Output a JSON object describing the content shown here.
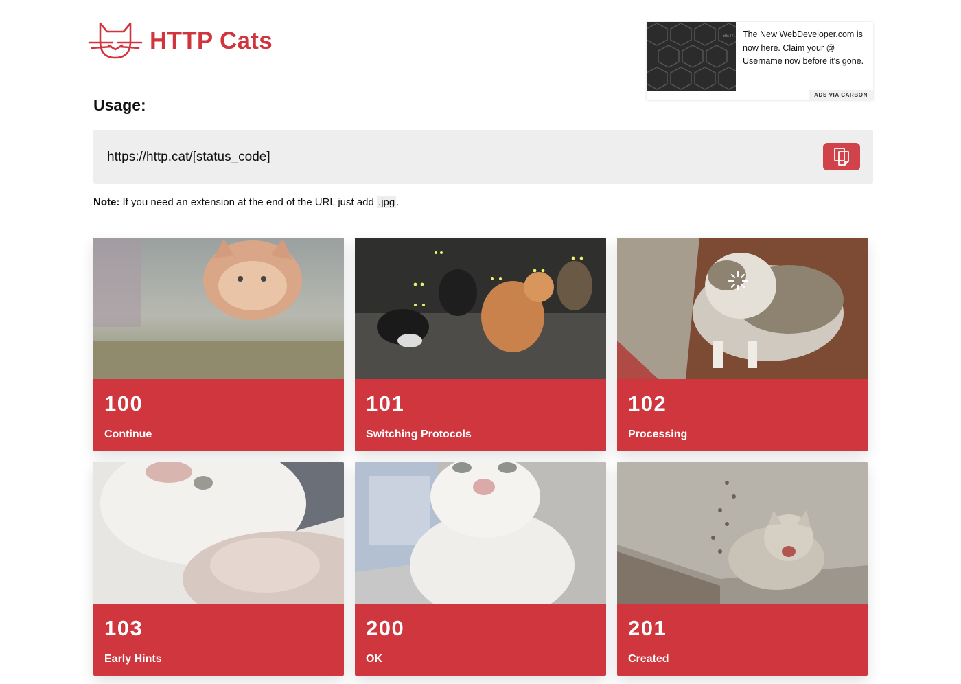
{
  "header": {
    "logo_icon": "cat-logo-icon",
    "title": "HTTP Cats",
    "brand_color": "#d0343d"
  },
  "ad": {
    "text": "The New WebDeveloper.com is now here. Claim your @ Username now before it's gone.",
    "via": "ADS VIA CARBON",
    "image_label": "BETA"
  },
  "usage": {
    "title": "Usage:",
    "url": "https://http.cat/[status_code]",
    "copy_icon": "copy-icon"
  },
  "note": {
    "bold": "Note:",
    "text": " If you need an extension at the end of the URL just add ",
    "code": ".jpg",
    "end": "."
  },
  "cards": [
    {
      "code": "100",
      "label": "Continue"
    },
    {
      "code": "101",
      "label": "Switching Protocols"
    },
    {
      "code": "102",
      "label": "Processing"
    },
    {
      "code": "103",
      "label": "Early Hints"
    },
    {
      "code": "200",
      "label": "OK"
    },
    {
      "code": "201",
      "label": "Created"
    }
  ]
}
